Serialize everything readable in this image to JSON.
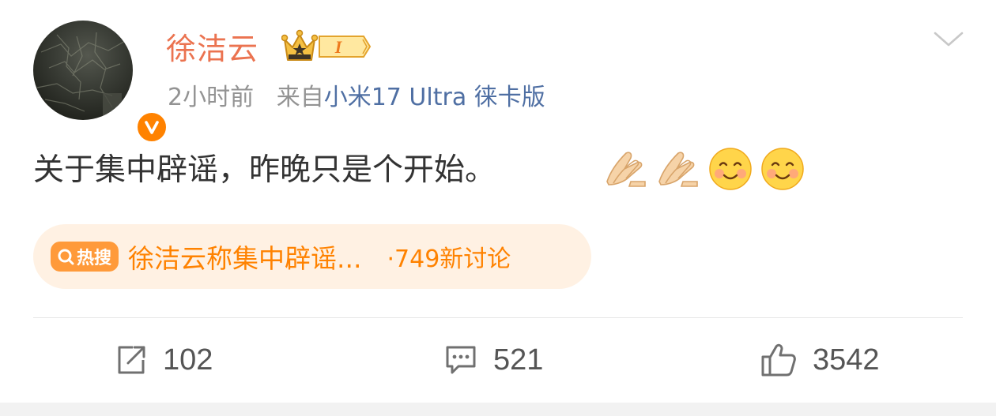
{
  "author": {
    "name": "徐洁云",
    "level_badge": "I",
    "avatar_icon": "avatar-image",
    "verified_icon": "v-badge-icon"
  },
  "meta": {
    "time": "2小时前",
    "from_label": "来自",
    "source": "小米17 Ultra 徕卡版"
  },
  "post": {
    "text": "关于集中辟谣，昨晚只是个开始。",
    "emojis": [
      "pray-hands-emoji",
      "pray-hands-emoji",
      "smile-emoji",
      "smile-emoji"
    ]
  },
  "hot_search": {
    "badge_label": "热搜",
    "title": "徐洁云称集中辟谣...",
    "count_text": "·749新讨论"
  },
  "actions": {
    "repost_count": "102",
    "comment_count": "521",
    "like_count": "3542"
  },
  "colors": {
    "name": "#eb7350",
    "meta": "#939393",
    "source": "#4f6fa3",
    "hot_bg": "#fff1e3",
    "hot_accent": "#ff8200"
  }
}
